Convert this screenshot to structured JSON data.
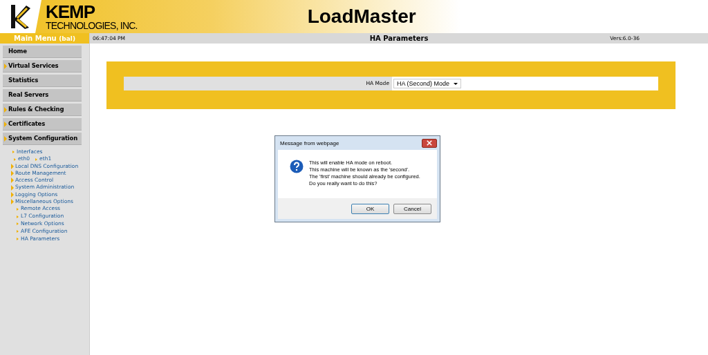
{
  "header": {
    "company": "KEMP",
    "company_sub": "TECHNOLOGIES, INC.",
    "product": "LoadMaster"
  },
  "sidebar": {
    "title": "Main Menu",
    "user": "(bal)",
    "items": [
      {
        "label": "Home",
        "expandable": false
      },
      {
        "label": "Virtual Services",
        "expandable": true
      },
      {
        "label": "Statistics",
        "expandable": false
      },
      {
        "label": "Real Servers",
        "expandable": false
      },
      {
        "label": "Rules & Checking",
        "expandable": true
      },
      {
        "label": "Certificates",
        "expandable": true
      },
      {
        "label": "System Configuration",
        "expandable": true,
        "children": [
          {
            "label": "Interfaces",
            "kind": "link",
            "children": [
              {
                "label": "eth0"
              },
              {
                "label": "eth1"
              }
            ]
          },
          {
            "label": "Local DNS Configuration",
            "kind": "folder"
          },
          {
            "label": "Route Management",
            "kind": "folder"
          },
          {
            "label": "Access Control",
            "kind": "folder"
          },
          {
            "label": "System Administration",
            "kind": "folder"
          },
          {
            "label": "Logging Options",
            "kind": "folder"
          },
          {
            "label": "Miscellaneous Options",
            "kind": "folder",
            "children": [
              {
                "label": "Remote Access"
              },
              {
                "label": "L7 Configuration"
              },
              {
                "label": "Network Options"
              },
              {
                "label": "AFE Configuration"
              },
              {
                "label": "HA Parameters"
              }
            ]
          }
        ]
      }
    ]
  },
  "topbar": {
    "time": "06:47:04 PM",
    "title": "HA Parameters",
    "version": "Vers:6.0-36"
  },
  "form": {
    "label": "HA Mode",
    "value": "HA (Second) Mode"
  },
  "dialog": {
    "title": "Message from webpage",
    "lines": [
      "This will enable HA mode on reboot.",
      "This machine will be known as the 'second'.",
      "The 'first' machine should already be configured.",
      "Do you really want to do this?"
    ],
    "buttons": [
      "OK",
      "Cancel"
    ]
  }
}
